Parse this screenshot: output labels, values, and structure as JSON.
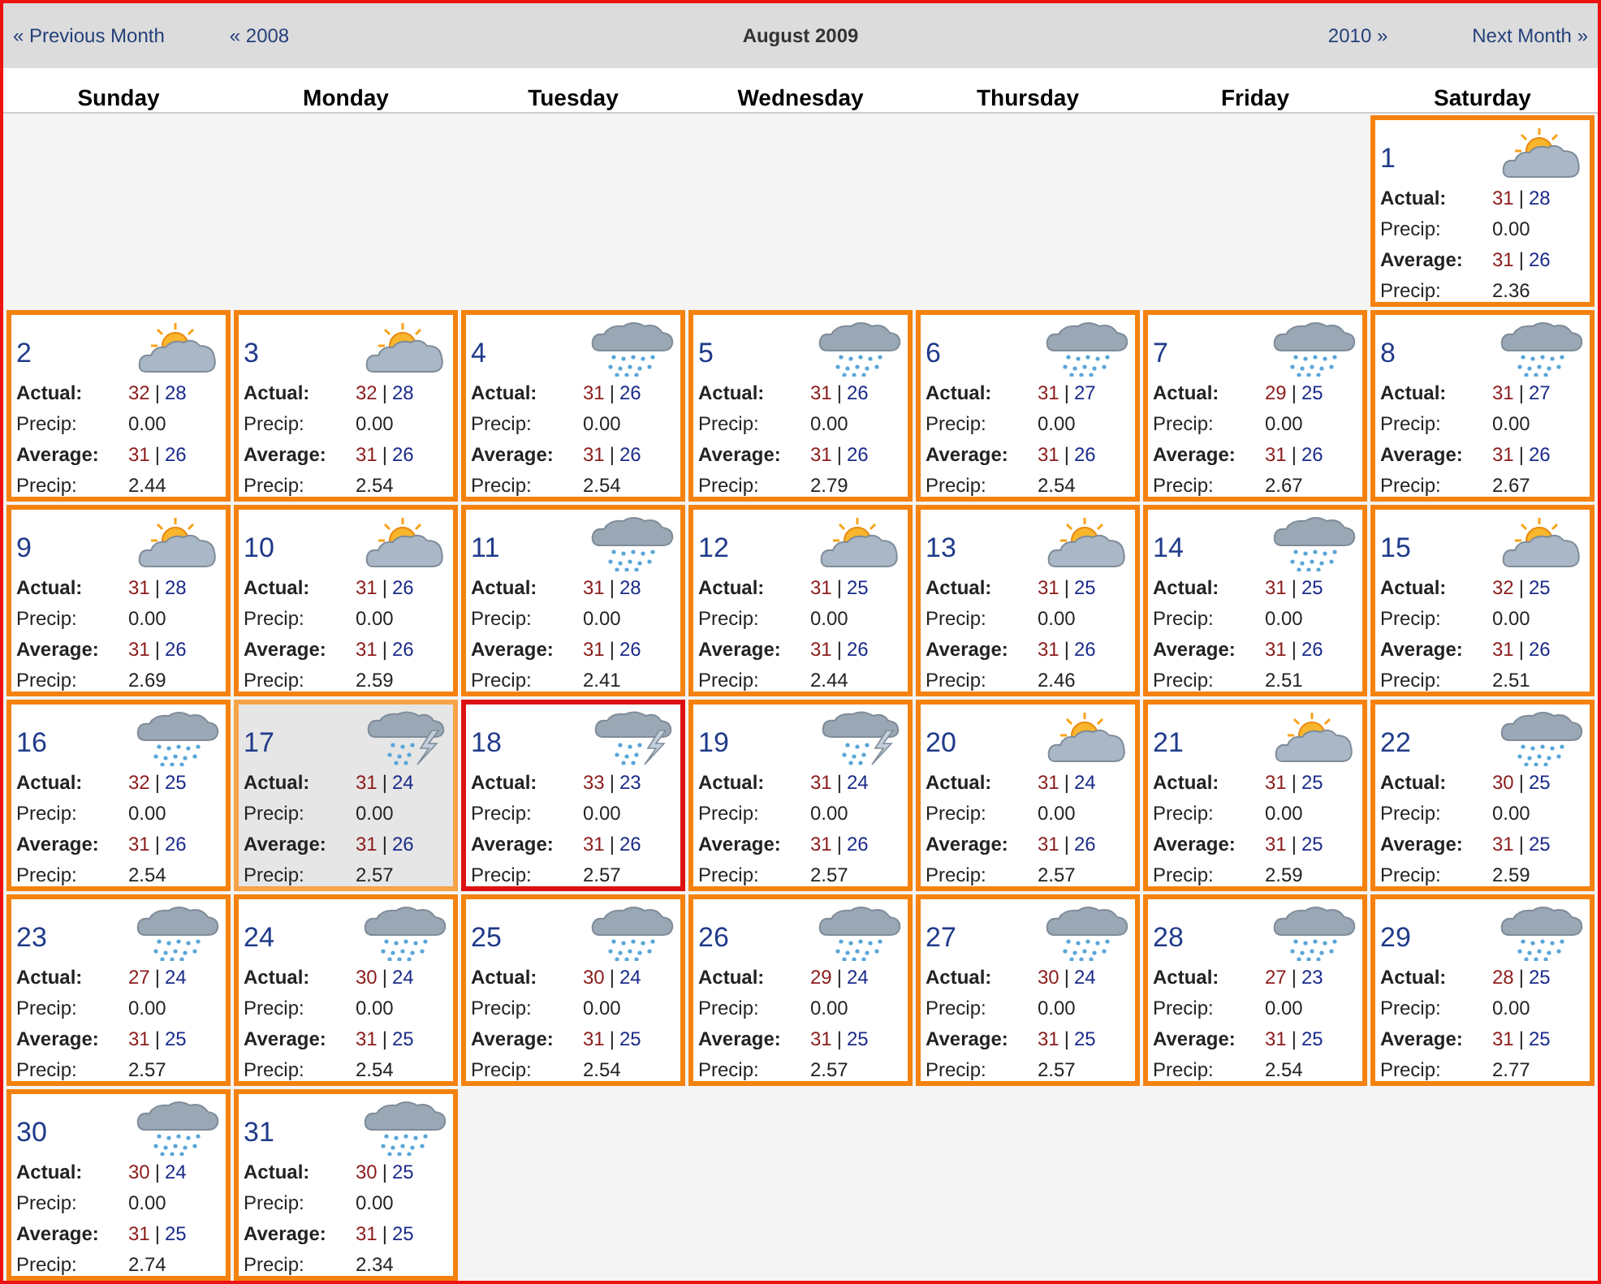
{
  "header": {
    "previous_month": "« Previous Month",
    "previous_year": "« 2008",
    "title": "August 2009",
    "next_year": "2010 »",
    "next_month": "Next Month »"
  },
  "weekdays": [
    "Sunday",
    "Monday",
    "Tuesday",
    "Wednesday",
    "Thursday",
    "Friday",
    "Saturday"
  ],
  "weeks": [
    [
      {
        "kind": "blank"
      },
      {
        "kind": "blank"
      },
      {
        "kind": "blank"
      },
      {
        "kind": "blank"
      },
      {
        "kind": "blank"
      },
      {
        "kind": "blank"
      },
      {
        "day": "1",
        "kind": "sun-cloud",
        "selected": false,
        "highlighted": false,
        "rows": [
          {
            "label": "Actual:",
            "hi": "31",
            "sep": "|",
            "lo": "28"
          },
          {
            "label": "Precip:",
            "value": "0.00"
          },
          {
            "label": "Average:",
            "hi": "31",
            "sep": "|",
            "lo": "26"
          },
          {
            "label": "Precip:",
            "value": "2.36"
          }
        ]
      }
    ],
    [
      {
        "day": "2",
        "kind": "sun-cloud",
        "selected": false,
        "highlighted": false,
        "rows": [
          {
            "label": "Actual:",
            "hi": "32",
            "sep": "|",
            "lo": "28"
          },
          {
            "label": "Precip:",
            "value": "0.00"
          },
          {
            "label": "Average:",
            "hi": "31",
            "sep": "|",
            "lo": "26"
          },
          {
            "label": "Precip:",
            "value": "2.44"
          }
        ]
      },
      {
        "day": "3",
        "kind": "sun-cloud",
        "selected": false,
        "highlighted": false,
        "rows": [
          {
            "label": "Actual:",
            "hi": "32",
            "sep": "|",
            "lo": "28"
          },
          {
            "label": "Precip:",
            "value": "0.00"
          },
          {
            "label": "Average:",
            "hi": "31",
            "sep": "|",
            "lo": "26"
          },
          {
            "label": "Precip:",
            "value": "2.54"
          }
        ]
      },
      {
        "day": "4",
        "kind": "rain",
        "selected": false,
        "highlighted": false,
        "rows": [
          {
            "label": "Actual:",
            "hi": "31",
            "sep": "|",
            "lo": "26"
          },
          {
            "label": "Precip:",
            "value": "0.00"
          },
          {
            "label": "Average:",
            "hi": "31",
            "sep": "|",
            "lo": "26"
          },
          {
            "label": "Precip:",
            "value": "2.54"
          }
        ]
      },
      {
        "day": "5",
        "kind": "rain",
        "selected": false,
        "highlighted": false,
        "rows": [
          {
            "label": "Actual:",
            "hi": "31",
            "sep": "|",
            "lo": "26"
          },
          {
            "label": "Precip:",
            "value": "0.00"
          },
          {
            "label": "Average:",
            "hi": "31",
            "sep": "|",
            "lo": "26"
          },
          {
            "label": "Precip:",
            "value": "2.79"
          }
        ]
      },
      {
        "day": "6",
        "kind": "rain",
        "selected": false,
        "highlighted": false,
        "rows": [
          {
            "label": "Actual:",
            "hi": "31",
            "sep": "|",
            "lo": "27"
          },
          {
            "label": "Precip:",
            "value": "0.00"
          },
          {
            "label": "Average:",
            "hi": "31",
            "sep": "|",
            "lo": "26"
          },
          {
            "label": "Precip:",
            "value": "2.54"
          }
        ]
      },
      {
        "day": "7",
        "kind": "rain",
        "selected": false,
        "highlighted": false,
        "rows": [
          {
            "label": "Actual:",
            "hi": "29",
            "sep": "|",
            "lo": "25"
          },
          {
            "label": "Precip:",
            "value": "0.00"
          },
          {
            "label": "Average:",
            "hi": "31",
            "sep": "|",
            "lo": "26"
          },
          {
            "label": "Precip:",
            "value": "2.67"
          }
        ]
      },
      {
        "day": "8",
        "kind": "rain",
        "selected": false,
        "highlighted": false,
        "rows": [
          {
            "label": "Actual:",
            "hi": "31",
            "sep": "|",
            "lo": "27"
          },
          {
            "label": "Precip:",
            "value": "0.00"
          },
          {
            "label": "Average:",
            "hi": "31",
            "sep": "|",
            "lo": "26"
          },
          {
            "label": "Precip:",
            "value": "2.67"
          }
        ]
      }
    ],
    [
      {
        "day": "9",
        "kind": "sun-cloud",
        "selected": false,
        "highlighted": false,
        "rows": [
          {
            "label": "Actual:",
            "hi": "31",
            "sep": "|",
            "lo": "28"
          },
          {
            "label": "Precip:",
            "value": "0.00"
          },
          {
            "label": "Average:",
            "hi": "31",
            "sep": "|",
            "lo": "26"
          },
          {
            "label": "Precip:",
            "value": "2.69"
          }
        ]
      },
      {
        "day": "10",
        "kind": "sun-cloud",
        "selected": false,
        "highlighted": false,
        "rows": [
          {
            "label": "Actual:",
            "hi": "31",
            "sep": "|",
            "lo": "26"
          },
          {
            "label": "Precip:",
            "value": "0.00"
          },
          {
            "label": "Average:",
            "hi": "31",
            "sep": "|",
            "lo": "26"
          },
          {
            "label": "Precip:",
            "value": "2.59"
          }
        ]
      },
      {
        "day": "11",
        "kind": "rain",
        "selected": false,
        "highlighted": false,
        "rows": [
          {
            "label": "Actual:",
            "hi": "31",
            "sep": "|",
            "lo": "28"
          },
          {
            "label": "Precip:",
            "value": "0.00"
          },
          {
            "label": "Average:",
            "hi": "31",
            "sep": "|",
            "lo": "26"
          },
          {
            "label": "Precip:",
            "value": "2.41"
          }
        ]
      },
      {
        "day": "12",
        "kind": "sun-cloud",
        "selected": false,
        "highlighted": false,
        "rows": [
          {
            "label": "Actual:",
            "hi": "31",
            "sep": "|",
            "lo": "25"
          },
          {
            "label": "Precip:",
            "value": "0.00"
          },
          {
            "label": "Average:",
            "hi": "31",
            "sep": "|",
            "lo": "26"
          },
          {
            "label": "Precip:",
            "value": "2.44"
          }
        ]
      },
      {
        "day": "13",
        "kind": "sun-cloud",
        "selected": false,
        "highlighted": false,
        "rows": [
          {
            "label": "Actual:",
            "hi": "31",
            "sep": "|",
            "lo": "25"
          },
          {
            "label": "Precip:",
            "value": "0.00"
          },
          {
            "label": "Average:",
            "hi": "31",
            "sep": "|",
            "lo": "26"
          },
          {
            "label": "Precip:",
            "value": "2.46"
          }
        ]
      },
      {
        "day": "14",
        "kind": "rain",
        "selected": false,
        "highlighted": false,
        "rows": [
          {
            "label": "Actual:",
            "hi": "31",
            "sep": "|",
            "lo": "25"
          },
          {
            "label": "Precip:",
            "value": "0.00"
          },
          {
            "label": "Average:",
            "hi": "31",
            "sep": "|",
            "lo": "26"
          },
          {
            "label": "Precip:",
            "value": "2.51"
          }
        ]
      },
      {
        "day": "15",
        "kind": "sun-cloud",
        "selected": false,
        "highlighted": false,
        "rows": [
          {
            "label": "Actual:",
            "hi": "32",
            "sep": "|",
            "lo": "25"
          },
          {
            "label": "Precip:",
            "value": "0.00"
          },
          {
            "label": "Average:",
            "hi": "31",
            "sep": "|",
            "lo": "26"
          },
          {
            "label": "Precip:",
            "value": "2.51"
          }
        ]
      }
    ],
    [
      {
        "day": "16",
        "kind": "rain",
        "selected": false,
        "highlighted": false,
        "rows": [
          {
            "label": "Actual:",
            "hi": "32",
            "sep": "|",
            "lo": "25"
          },
          {
            "label": "Precip:",
            "value": "0.00"
          },
          {
            "label": "Average:",
            "hi": "31",
            "sep": "|",
            "lo": "26"
          },
          {
            "label": "Precip:",
            "value": "2.54"
          }
        ]
      },
      {
        "day": "17",
        "kind": "storm",
        "selected": false,
        "highlighted": true,
        "rows": [
          {
            "label": "Actual:",
            "hi": "31",
            "sep": "|",
            "lo": "24"
          },
          {
            "label": "Precip:",
            "value": "0.00"
          },
          {
            "label": "Average:",
            "hi": "31",
            "sep": "|",
            "lo": "26"
          },
          {
            "label": "Precip:",
            "value": "2.57"
          }
        ]
      },
      {
        "day": "18",
        "kind": "storm",
        "selected": true,
        "highlighted": false,
        "rows": [
          {
            "label": "Actual:",
            "hi": "33",
            "sep": "|",
            "lo": "23"
          },
          {
            "label": "Precip:",
            "value": "0.00"
          },
          {
            "label": "Average:",
            "hi": "31",
            "sep": "|",
            "lo": "26"
          },
          {
            "label": "Precip:",
            "value": "2.57"
          }
        ]
      },
      {
        "day": "19",
        "kind": "storm",
        "selected": false,
        "highlighted": false,
        "rows": [
          {
            "label": "Actual:",
            "hi": "31",
            "sep": "|",
            "lo": "24"
          },
          {
            "label": "Precip:",
            "value": "0.00"
          },
          {
            "label": "Average:",
            "hi": "31",
            "sep": "|",
            "lo": "26"
          },
          {
            "label": "Precip:",
            "value": "2.57"
          }
        ]
      },
      {
        "day": "20",
        "kind": "sun-cloud",
        "selected": false,
        "highlighted": false,
        "rows": [
          {
            "label": "Actual:",
            "hi": "31",
            "sep": "|",
            "lo": "24"
          },
          {
            "label": "Precip:",
            "value": "0.00"
          },
          {
            "label": "Average:",
            "hi": "31",
            "sep": "|",
            "lo": "26"
          },
          {
            "label": "Precip:",
            "value": "2.57"
          }
        ]
      },
      {
        "day": "21",
        "kind": "sun-cloud",
        "selected": false,
        "highlighted": false,
        "rows": [
          {
            "label": "Actual:",
            "hi": "31",
            "sep": "|",
            "lo": "25"
          },
          {
            "label": "Precip:",
            "value": "0.00"
          },
          {
            "label": "Average:",
            "hi": "31",
            "sep": "|",
            "lo": "25"
          },
          {
            "label": "Precip:",
            "value": "2.59"
          }
        ]
      },
      {
        "day": "22",
        "kind": "rain",
        "selected": false,
        "highlighted": false,
        "rows": [
          {
            "label": "Actual:",
            "hi": "30",
            "sep": "|",
            "lo": "25"
          },
          {
            "label": "Precip:",
            "value": "0.00"
          },
          {
            "label": "Average:",
            "hi": "31",
            "sep": "|",
            "lo": "25"
          },
          {
            "label": "Precip:",
            "value": "2.59"
          }
        ]
      }
    ],
    [
      {
        "day": "23",
        "kind": "rain",
        "selected": false,
        "highlighted": false,
        "rows": [
          {
            "label": "Actual:",
            "hi": "27",
            "sep": "|",
            "lo": "24"
          },
          {
            "label": "Precip:",
            "value": "0.00"
          },
          {
            "label": "Average:",
            "hi": "31",
            "sep": "|",
            "lo": "25"
          },
          {
            "label": "Precip:",
            "value": "2.57"
          }
        ]
      },
      {
        "day": "24",
        "kind": "rain",
        "selected": false,
        "highlighted": false,
        "rows": [
          {
            "label": "Actual:",
            "hi": "30",
            "sep": "|",
            "lo": "24"
          },
          {
            "label": "Precip:",
            "value": "0.00"
          },
          {
            "label": "Average:",
            "hi": "31",
            "sep": "|",
            "lo": "25"
          },
          {
            "label": "Precip:",
            "value": "2.54"
          }
        ]
      },
      {
        "day": "25",
        "kind": "rain",
        "selected": false,
        "highlighted": false,
        "rows": [
          {
            "label": "Actual:",
            "hi": "30",
            "sep": "|",
            "lo": "24"
          },
          {
            "label": "Precip:",
            "value": "0.00"
          },
          {
            "label": "Average:",
            "hi": "31",
            "sep": "|",
            "lo": "25"
          },
          {
            "label": "Precip:",
            "value": "2.54"
          }
        ]
      },
      {
        "day": "26",
        "kind": "rain",
        "selected": false,
        "highlighted": false,
        "rows": [
          {
            "label": "Actual:",
            "hi": "29",
            "sep": "|",
            "lo": "24"
          },
          {
            "label": "Precip:",
            "value": "0.00"
          },
          {
            "label": "Average:",
            "hi": "31",
            "sep": "|",
            "lo": "25"
          },
          {
            "label": "Precip:",
            "value": "2.57"
          }
        ]
      },
      {
        "day": "27",
        "kind": "rain",
        "selected": false,
        "highlighted": false,
        "rows": [
          {
            "label": "Actual:",
            "hi": "30",
            "sep": "|",
            "lo": "24"
          },
          {
            "label": "Precip:",
            "value": "0.00"
          },
          {
            "label": "Average:",
            "hi": "31",
            "sep": "|",
            "lo": "25"
          },
          {
            "label": "Precip:",
            "value": "2.57"
          }
        ]
      },
      {
        "day": "28",
        "kind": "rain",
        "selected": false,
        "highlighted": false,
        "rows": [
          {
            "label": "Actual:",
            "hi": "27",
            "sep": "|",
            "lo": "23"
          },
          {
            "label": "Precip:",
            "value": "0.00"
          },
          {
            "label": "Average:",
            "hi": "31",
            "sep": "|",
            "lo": "25"
          },
          {
            "label": "Precip:",
            "value": "2.54"
          }
        ]
      },
      {
        "day": "29",
        "kind": "rain",
        "selected": false,
        "highlighted": false,
        "rows": [
          {
            "label": "Actual:",
            "hi": "28",
            "sep": "|",
            "lo": "25"
          },
          {
            "label": "Precip:",
            "value": "0.00"
          },
          {
            "label": "Average:",
            "hi": "31",
            "sep": "|",
            "lo": "25"
          },
          {
            "label": "Precip:",
            "value": "2.77"
          }
        ]
      }
    ],
    [
      {
        "day": "30",
        "kind": "rain",
        "selected": false,
        "highlighted": false,
        "rows": [
          {
            "label": "Actual:",
            "hi": "30",
            "sep": "|",
            "lo": "24"
          },
          {
            "label": "Precip:",
            "value": "0.00"
          },
          {
            "label": "Average:",
            "hi": "31",
            "sep": "|",
            "lo": "25"
          },
          {
            "label": "Precip:",
            "value": "2.74"
          }
        ]
      },
      {
        "day": "31",
        "kind": "rain",
        "selected": false,
        "highlighted": false,
        "rows": [
          {
            "label": "Actual:",
            "hi": "30",
            "sep": "|",
            "lo": "25"
          },
          {
            "label": "Precip:",
            "value": "0.00"
          },
          {
            "label": "Average:",
            "hi": "31",
            "sep": "|",
            "lo": "25"
          },
          {
            "label": "Precip:",
            "value": "2.34"
          }
        ]
      },
      {
        "kind": "blank"
      },
      {
        "kind": "blank"
      },
      {
        "kind": "blank"
      },
      {
        "kind": "blank"
      },
      {
        "kind": "blank"
      }
    ]
  ]
}
